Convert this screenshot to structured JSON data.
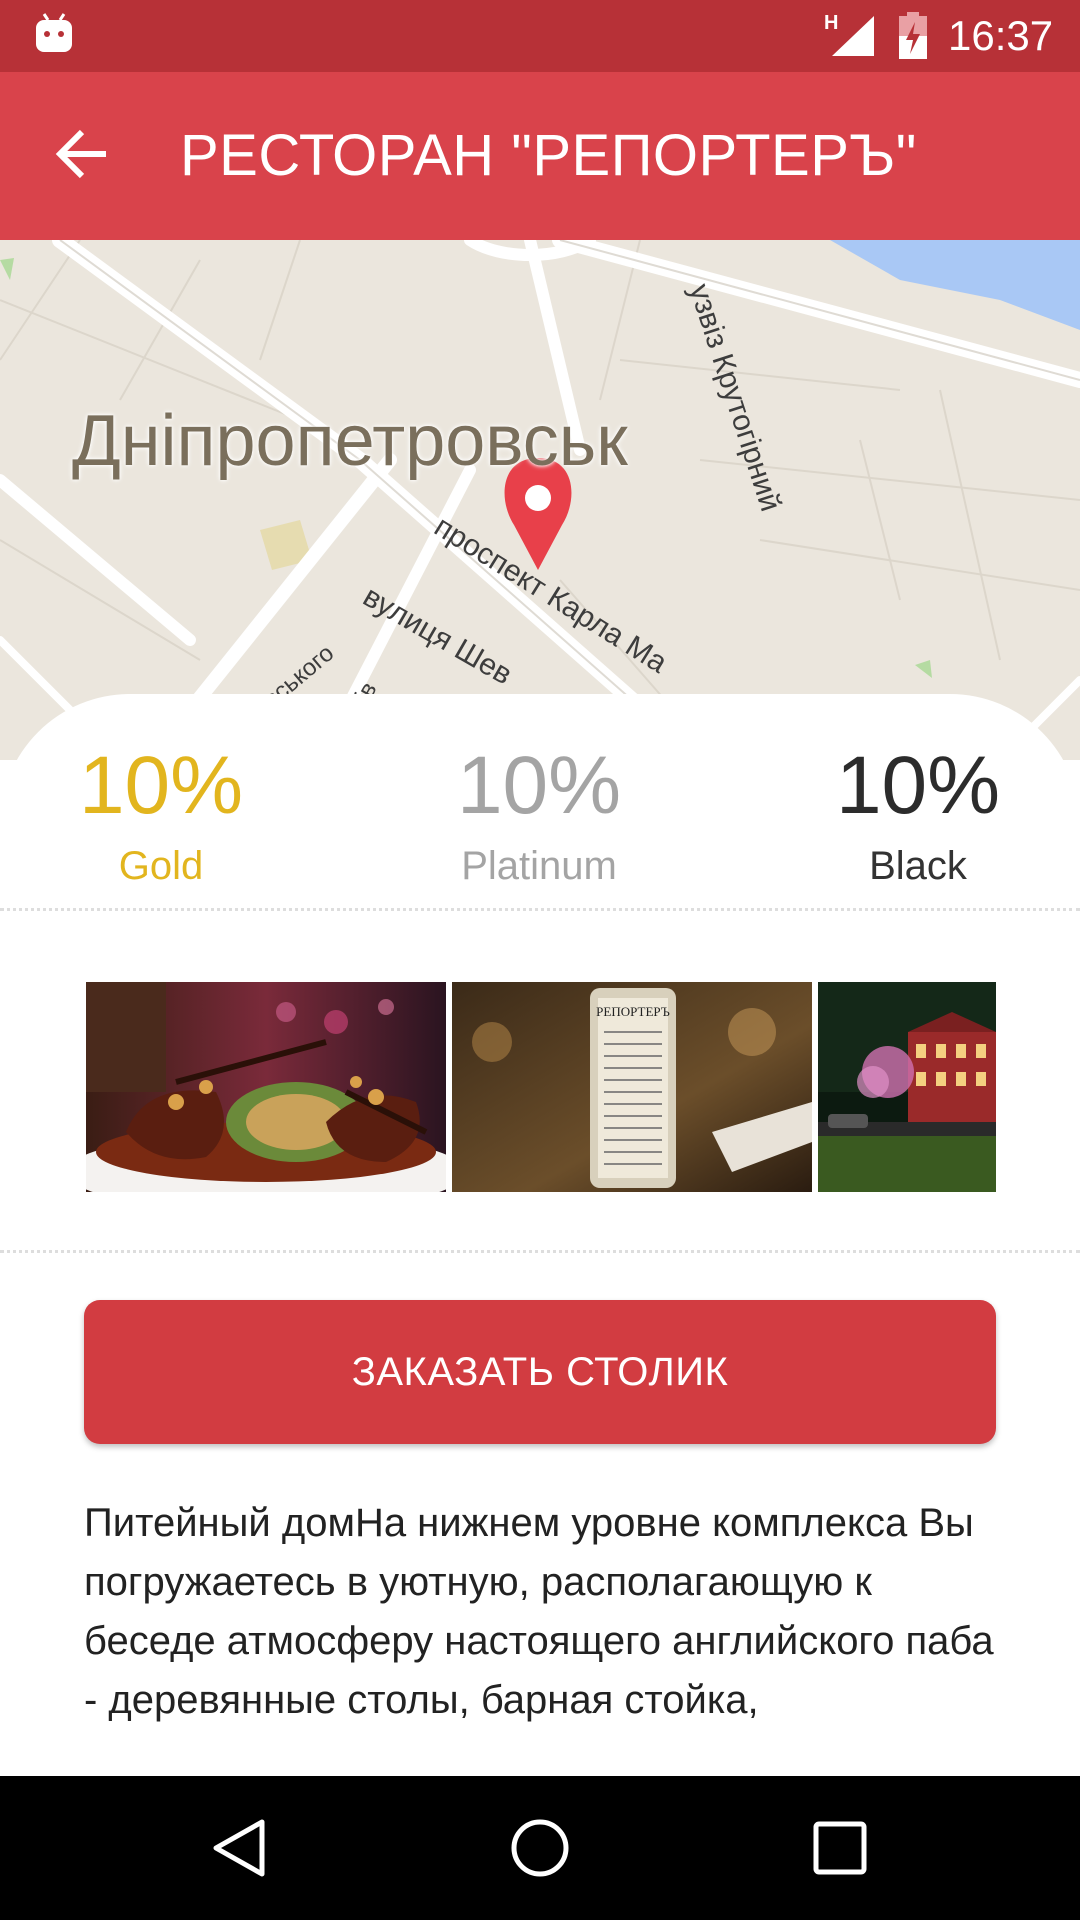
{
  "status_bar": {
    "network": "H",
    "time": "16:37",
    "icons": [
      "android-notification-icon",
      "signal-icon",
      "battery-charging-icon"
    ]
  },
  "app_bar": {
    "title": "РЕСТОРАН \"РЕПОРТЕРЪ\"",
    "back_icon": "arrow-back-icon"
  },
  "map": {
    "city_label": "Дніпропетровськ",
    "road_labels": [
      "узвіз Крутогірний",
      "проспект Карла Ма",
      "вулиця Шев",
      "цевського",
      "льців"
    ],
    "marker_icon": "map-pin-icon",
    "colors": {
      "land": "#ebe6dd",
      "water": "#a9c8f5",
      "road": "#ffffff",
      "marker": "#e8404a"
    }
  },
  "discounts": [
    {
      "percent": "10%",
      "tier": "Gold",
      "color": "#e2b51e"
    },
    {
      "percent": "10%",
      "tier": "Platinum",
      "color": "#a4a4a4"
    },
    {
      "percent": "10%",
      "tier": "Black",
      "color": "#2c2c2c"
    }
  ],
  "gallery": {
    "photos": [
      "dish-photo",
      "menu-bottle-photo",
      "building-night-photo"
    ],
    "menu_bottle_text": "РЕПОРТЕРЪ"
  },
  "book_button": {
    "label": "ЗАКАЗАТЬ СТОЛИК"
  },
  "description": "Питейный домНа нижнем уровне комплекса Вы погружаетесь в уютную, располагающую к беседе атмосферу настоящего английского паба - деревянные столы, барная стойка,",
  "nav_bar": {
    "icons": [
      "back-triangle-icon",
      "home-circle-icon",
      "recents-square-icon"
    ]
  },
  "colors": {
    "status_bar": "#b73137",
    "app_bar": "#d9434b",
    "accent_button": "#d23c41"
  }
}
